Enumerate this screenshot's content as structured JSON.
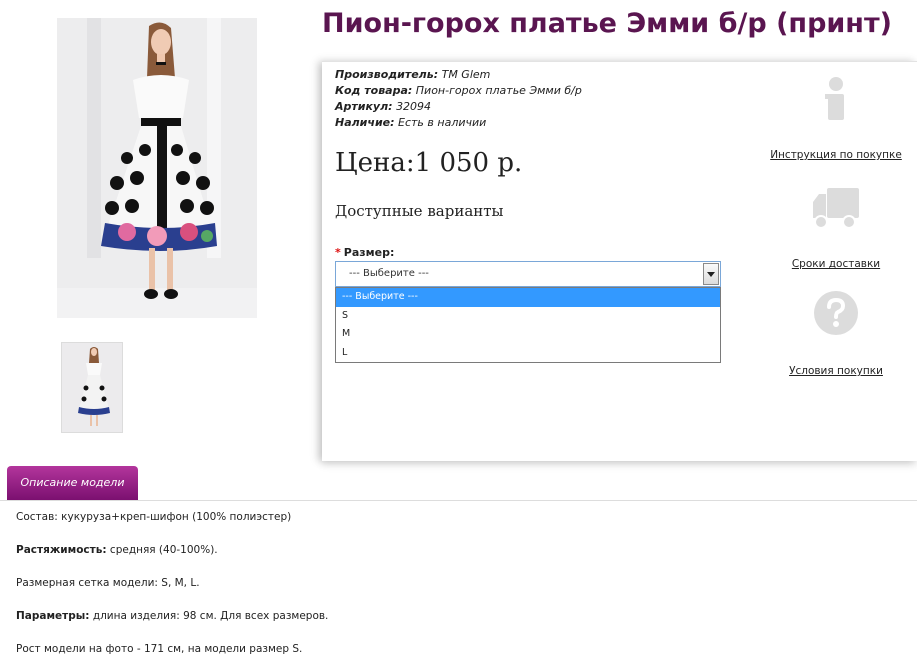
{
  "product": {
    "title": "Пион-горох платье Эмми б/р (принт)",
    "meta": [
      {
        "label": "Производитель:",
        "value": "TM Glem"
      },
      {
        "label": "Код товара:",
        "value": "Пион-горох платье Эмми б/р"
      },
      {
        "label": "Артикул:",
        "value": "32094"
      },
      {
        "label": "Наличие:",
        "value": "Есть в наличии"
      }
    ],
    "price": "Цена:1 050 р.",
    "variants_heading": "Доступные варианты",
    "size": {
      "required_mark": "*",
      "label": "Размер:",
      "selected": "--- Выберите ---",
      "options": [
        "--- Выберите ---",
        "S",
        "M",
        "L"
      ]
    }
  },
  "side_links": [
    {
      "icon": "info-icon",
      "label": "Инструкция по покупке"
    },
    {
      "icon": "truck-icon",
      "label": "Сроки доставки"
    },
    {
      "icon": "question-icon",
      "label": "Условия покупки"
    }
  ],
  "tabs": [
    {
      "label": "Описание модели"
    }
  ],
  "description": [
    {
      "label": "",
      "text": "Состав: кукуруза+креп-шифон (100% полиэстер)"
    },
    {
      "label": "Растяжимость:",
      "text": " средняя (40-100%)."
    },
    {
      "label": "",
      "text": "Размерная сетка модели: S, M, L."
    },
    {
      "label": "Параметры:",
      "text": " длина изделия: 98 см. Для всех размеров."
    },
    {
      "label": "",
      "text": "Рост модели на фото - 171 см, на модели размер S."
    }
  ],
  "colors": {
    "title": "#5a1550",
    "tab": "#9a2088",
    "dropdown_selected": "#3399ff"
  }
}
